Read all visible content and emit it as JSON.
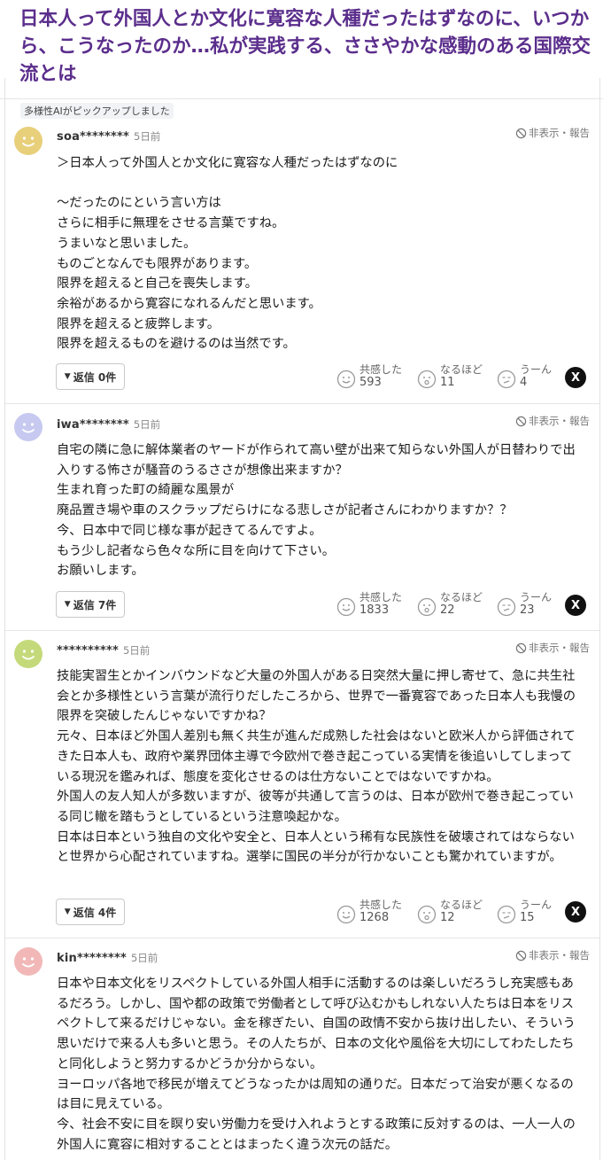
{
  "article": {
    "title": "日本人って外国人とか文化に寛容な人種だったはずなのに、いつから、こうなったのか…私が実践する、ささやかな感動のある国際交流とは"
  },
  "pick_badge": "多様性AIがピックアップしました",
  "labels": {
    "hide_report": "非表示・報告",
    "empathy": "共感した",
    "naruhodo": "なるほど",
    "uun": "うーん",
    "x_share": "X"
  },
  "colors": {
    "title": "#5b2e8c",
    "avatar_soa": "#e8cf7a",
    "avatar_iwa": "#c7c9f0",
    "avatar_anon": "#c4da7a",
    "avatar_kin": "#f2b8b8"
  },
  "comments": [
    {
      "user": "soa********",
      "time": "5日前",
      "avatar_icon": "smile-face-icon",
      "text": "＞日本人って外国人とか文化に寛容な人種だったはずなのに\n\n～だったのにという言い方は\nさらに相手に無理をさせる言葉ですね。\nうまいなと思いました。\nものごとなんでも限界があります。\n限界を超えると自己を喪失します。\n余裕があるから寛容になれるんだと思います。\n限界を超えると疲弊します。\n限界を超えるものを避けるのは当然です。",
      "reply": "返信 0件",
      "empathy": "593",
      "naruhodo": "11",
      "uun": "4"
    },
    {
      "user": "iwa********",
      "time": "5日前",
      "avatar_icon": "smile-face-icon",
      "text": "自宅の隣に急に解体業者のヤードが作られて高い壁が出来て知らない外国人が日替わりで出入りする怖さが騒音のうるささが想像出来ますか？\n生まれ育った町の綺麗な風景が\n廃品置き場や車のスクラップだらけになる悲しさが記者さんにわかりますか？？\n今、日本中で同じ様な事が起きてるんですよ。\nもう少し記者なら色々な所に目を向けて下さい。\nお願いします。",
      "reply": "返信 7件",
      "empathy": "1833",
      "naruhodo": "22",
      "uun": "23"
    },
    {
      "user": "**********",
      "time": "5日前",
      "avatar_icon": "smile-face-icon",
      "text": "技能実習生とかインバウンドなど大量の外国人がある日突然大量に押し寄せて、急に共生社会とか多様性という言葉が流行りだしたころから、世界で一番寛容であった日本人も我慢の限界を突破したんじゃないですかね？\n元々、日本ほど外国人差別も無く共生が進んだ成熟した社会はないと欧米人から評価されてきた日本人も、政府や業界団体主導で今欧州で巻き起こっている実情を後追いしてしまっている現況を鑑みれば、態度を変化させるのは仕方ないことではないですかね。\n外国人の友人知人が多数いますが、彼等が共通して言うのは、日本が欧州で巻き起こっている同じ轍を踏もうとしているという注意喚起かな。\n日本は日本という独自の文化や安全と、日本人という稀有な民族性を破壊されてはならないと世界から心配されていますね。選挙に国民の半分が行かないことも驚かれていますが。",
      "reply": "返信 4件",
      "empathy": "1268",
      "naruhodo": "12",
      "uun": "15"
    },
    {
      "user": "kin********",
      "time": "5日前",
      "avatar_icon": "smile-face-icon",
      "text": "日本や日本文化をリスペクトしている外国人相手に活動するのは楽しいだろうし充実感もあるだろう。しかし、国や都の政策で労働者として呼び込むかもしれない人たちは日本をリスペクトして来るだけじゃない。金を稼ぎたい、自国の政情不安から抜け出したい、そういう思いだけで来る人も多いと思う。その人たちが、日本の文化や風俗を大切にしてわたしたちと同化しようと努力するかどうか分からない。\nヨーロッパ各地で移民が増えてどうなったかは周知の通りだ。日本だって治安が悪くなるのは目に見えている。\n今、社会不安に目を瞑り安い労働力を受け入れようとする政策に反対するのは、一人一人の外国人に寛容に相対することとはまったく違う次元の話だ。"
    }
  ]
}
